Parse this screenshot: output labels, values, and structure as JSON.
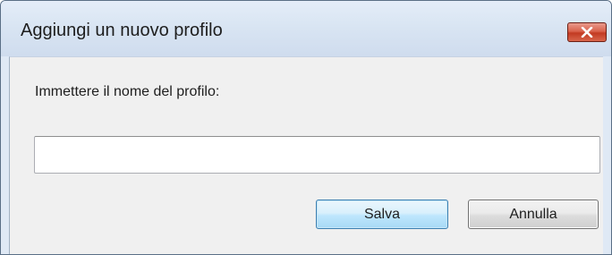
{
  "dialog": {
    "title": "Aggiungi un nuovo profilo",
    "prompt": "Immettere il nome del profilo:",
    "name_input": {
      "value": "",
      "placeholder": ""
    },
    "buttons": {
      "save_label": "Salva",
      "cancel_label": "Annulla"
    },
    "close_icon": "close-icon",
    "colors": {
      "close_button": "#c7432a",
      "save_button_border": "#3c7fb1",
      "title_bar": "#d9e5f3"
    }
  }
}
